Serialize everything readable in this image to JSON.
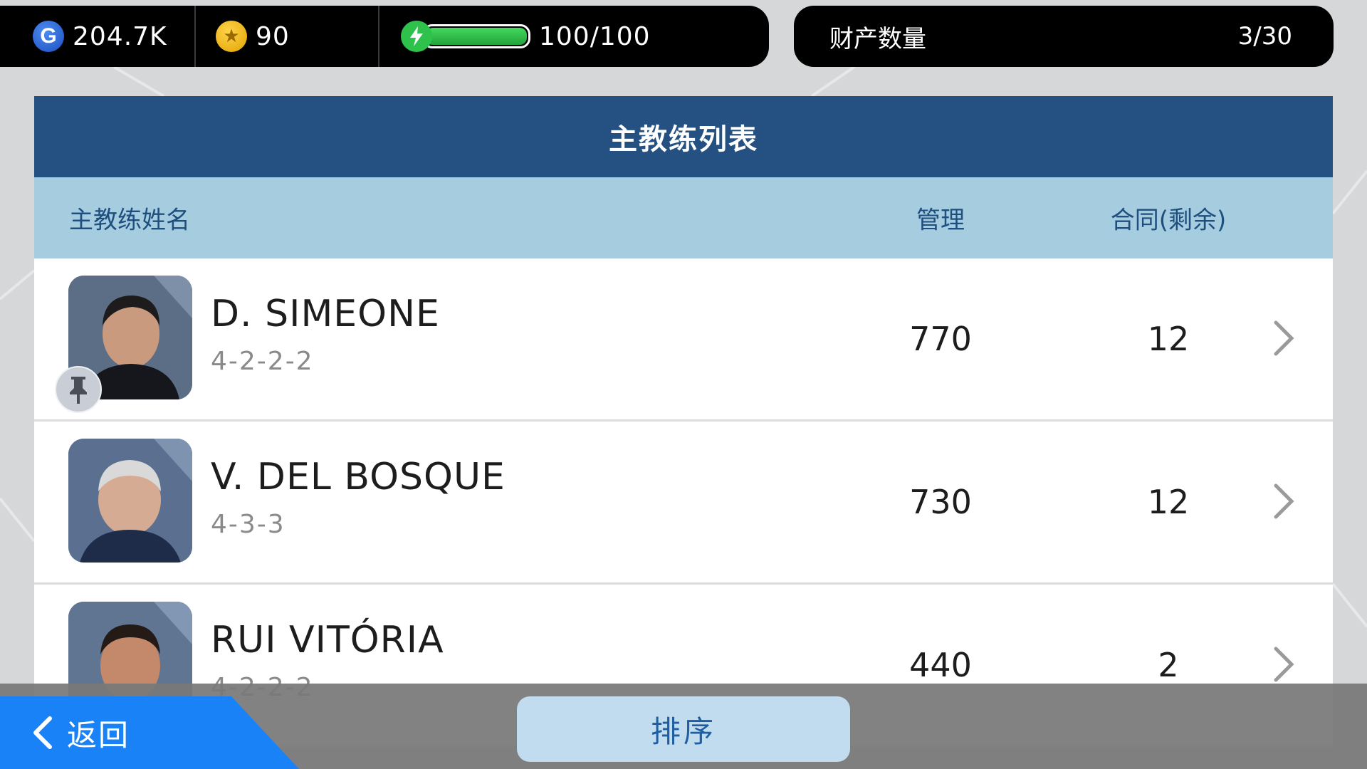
{
  "top_bar": {
    "gp_icon_letter": "G",
    "gp_value": "204.7K",
    "coins_value": "90",
    "energy_value": "100/100",
    "energy_level": 1.0
  },
  "assets": {
    "label": "财产数量",
    "count": "3/30"
  },
  "panel": {
    "title": "主教练列表",
    "columns": {
      "name": "主教练姓名",
      "management": "管理",
      "contract": "合同(剩余)"
    },
    "rows": [
      {
        "name": "D. SIMEONE",
        "formation": "4-2-2-2",
        "management": "770",
        "contract": "12",
        "pinned": true
      },
      {
        "name": "V. DEL BOSQUE",
        "formation": "4-3-3",
        "management": "730",
        "contract": "12",
        "pinned": false
      },
      {
        "name": "RUI VITÓRIA",
        "formation": "4-2-2-2",
        "management": "440",
        "contract": "2",
        "pinned": false
      }
    ]
  },
  "bottom": {
    "back_label": "返回",
    "sort_label": "排序"
  },
  "colors": {
    "title_bar": "#245182",
    "header_bar": "#a6cce0",
    "back_button": "#1a82f7",
    "sort_button": "#c2dcef",
    "energy_green": "#2ec24d"
  },
  "icons": [
    "gp-icon",
    "coin-icon",
    "energy-bolt-icon",
    "pin-icon",
    "chevron-right-icon",
    "chevron-left-icon"
  ]
}
